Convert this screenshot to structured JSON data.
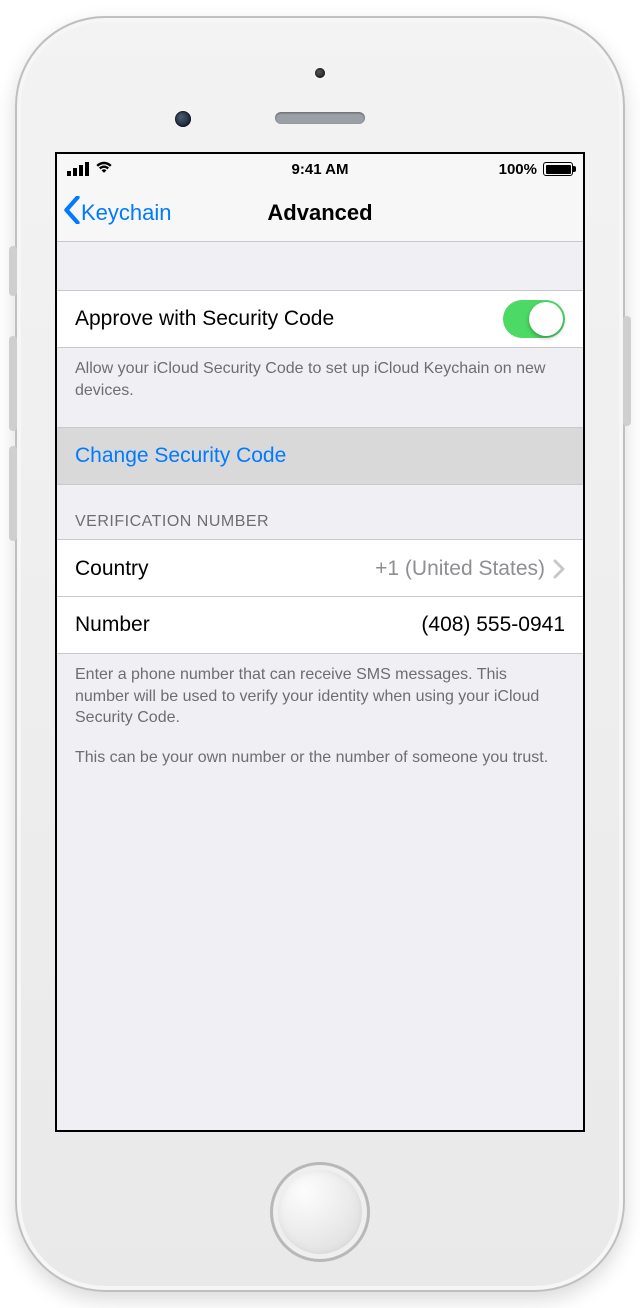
{
  "statusbar": {
    "time": "9:41 AM",
    "battery_pct": "100%"
  },
  "nav": {
    "back_label": "Keychain",
    "title": "Advanced"
  },
  "approve": {
    "label": "Approve with Security Code",
    "on": true,
    "footer": "Allow your iCloud Security Code to set up iCloud Keychain on new devices."
  },
  "change_code": {
    "label": "Change Security Code"
  },
  "verification": {
    "header": "Verification Number",
    "country_label": "Country",
    "country_value": "+1 (United States)",
    "number_label": "Number",
    "number_value": "(408) 555-0941",
    "footer_a": "Enter a phone number that can receive SMS messages. This number will be used to verify your identity when using your iCloud Security Code.",
    "footer_b": "This can be your own number or the number of someone you trust."
  }
}
